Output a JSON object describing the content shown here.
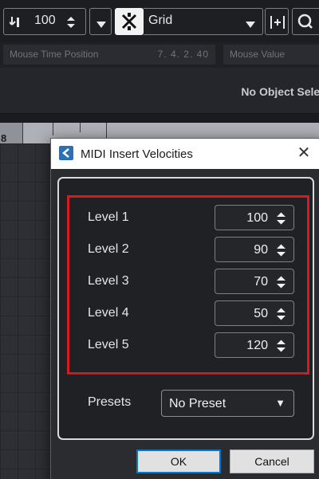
{
  "toolbar": {
    "velocity_value": "100",
    "snap_mode": "Grid"
  },
  "infoline": {
    "mouse_time_label": "Mouse Time Position",
    "mouse_time_value": "7. 4. 2. 40",
    "mouse_value_label": "Mouse Value"
  },
  "inspector": {
    "no_object_text": "No Object Selected"
  },
  "ruler": {
    "bar_label": "8"
  },
  "dialog": {
    "title": "MIDI Insert Velocities",
    "close_symbol": "✕",
    "levels": [
      {
        "label": "Level 1",
        "value": "100"
      },
      {
        "label": "Level 2",
        "value": "90"
      },
      {
        "label": "Level 3",
        "value": "70"
      },
      {
        "label": "Level 4",
        "value": "50"
      },
      {
        "label": "Level 5",
        "value": "120"
      }
    ],
    "presets_label": "Presets",
    "preset_value": "No Preset",
    "ok_label": "OK",
    "cancel_label": "Cancel"
  },
  "colors": {
    "highlight_border": "#d71a20",
    "ok_focus": "#0078d7",
    "title_icon": "#2b6fb5"
  }
}
